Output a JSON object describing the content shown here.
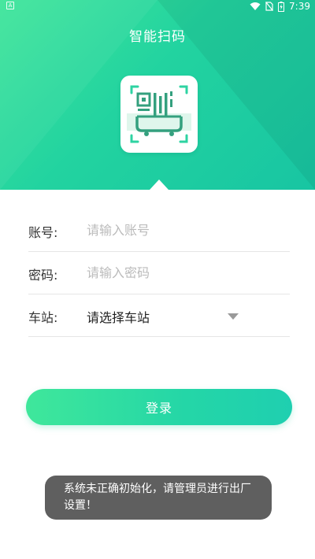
{
  "status_bar": {
    "left_indicator": "A",
    "time": "7:39",
    "icons": [
      "wifi-icon",
      "no-sim-icon",
      "battery-charging-icon"
    ]
  },
  "header": {
    "title": "智能扫码",
    "logo_icon": "qr-scan-logo-icon"
  },
  "form": {
    "account": {
      "label": "账号:",
      "placeholder": "请输入账号",
      "value": ""
    },
    "password": {
      "label": "密码:",
      "placeholder": "请输入密码",
      "value": ""
    },
    "station": {
      "label": "车站:",
      "selected": "请选择车站"
    }
  },
  "login_button": {
    "label": "登录"
  },
  "toast": {
    "message": "系统未正确初始化，请管理员进行出厂设置！"
  },
  "colors": {
    "accent": "#22d3a0",
    "accent_light": "#3fe59a",
    "toast_bg": "#5f5f5f",
    "divider": "#e6e6e6"
  }
}
